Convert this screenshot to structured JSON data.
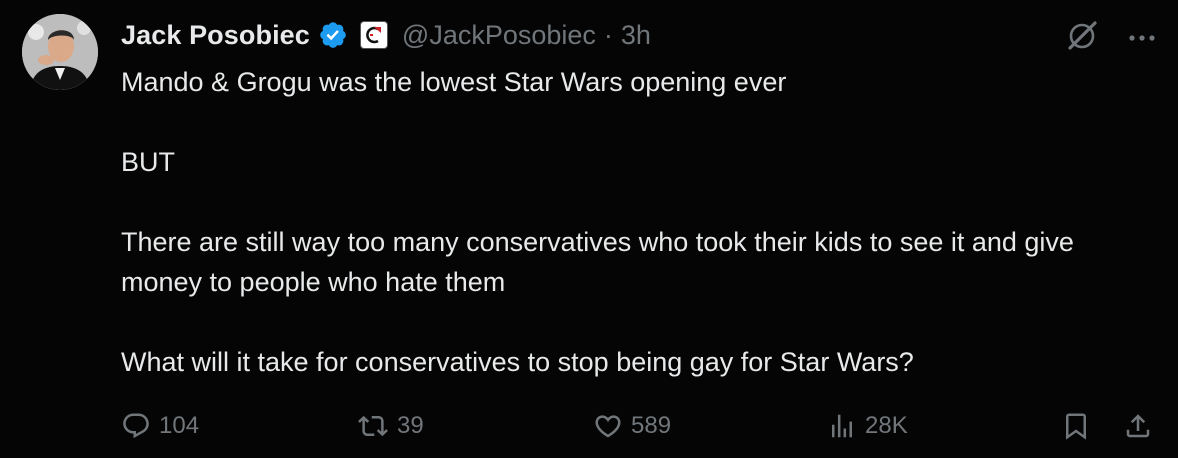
{
  "author": {
    "display_name": "Jack Posobiec",
    "handle": "@JackPosobiec",
    "separator": "·",
    "timestamp": "3h"
  },
  "tweet": {
    "paragraphs": [
      "Mando & Grogu was the lowest Star Wars opening ever",
      "BUT",
      "There are still way too many conservatives who took their kids to see it and give money to people who hate them",
      "What will it take for conservatives to stop being gay for Star Wars?"
    ]
  },
  "metrics": {
    "replies": "104",
    "reposts": "39",
    "likes": "589",
    "views": "28K"
  },
  "icons": {
    "verified": "verified-badge-icon",
    "affiliate": "affiliate-logo-icon",
    "grok": "grok-icon",
    "more": "more-icon",
    "reply": "reply-icon",
    "repost": "repost-icon",
    "like": "heart-icon",
    "views": "views-icon",
    "bookmark": "bookmark-icon",
    "share": "share-icon"
  },
  "colors": {
    "background": "#050505",
    "text_primary": "#e7e9ea",
    "text_secondary": "#71767b",
    "verified_blue": "#1d9bf0"
  }
}
